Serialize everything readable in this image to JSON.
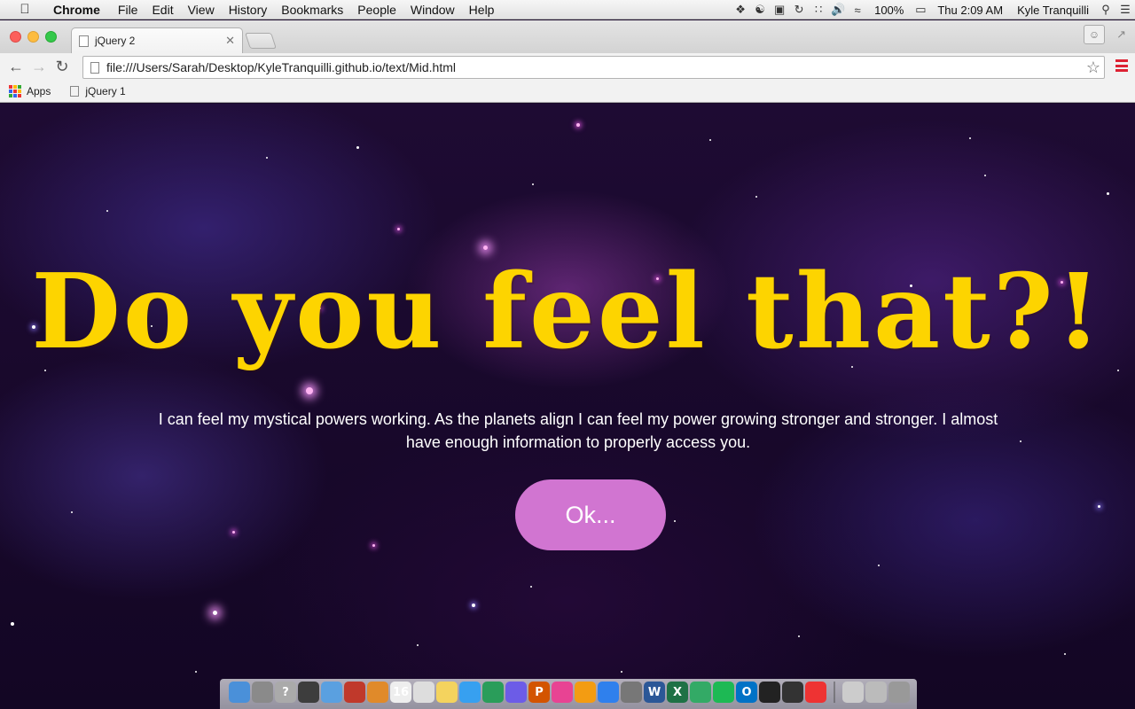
{
  "menubar": {
    "app_name": "Chrome",
    "items": [
      "File",
      "Edit",
      "View",
      "History",
      "Bookmarks",
      "People",
      "Window",
      "Help"
    ],
    "battery": "100%",
    "clock": "Thu 2:09 AM",
    "user": "Kyle Tranquilli"
  },
  "tab": {
    "title": "jQuery 2"
  },
  "toolbar": {
    "url": "file:///Users/Sarah/Desktop/KyleTranquilli.github.io/text/Mid.html"
  },
  "bookmarks": {
    "apps_label": "Apps",
    "items": [
      "jQuery 1"
    ]
  },
  "page": {
    "headline": "Do you feel that?!",
    "body": "I can feel my mystical powers working. As the planets align I can feel my power growing stronger and stronger. I almost have enough information to properly access you.",
    "button_label": "Ok..."
  },
  "colors": {
    "headline": "#fdd400",
    "button_bg": "#d175d1",
    "background": "#1e0b33"
  },
  "dock": {
    "icons": [
      "finder-icon",
      "launchpad-icon",
      "help-icon",
      "activity-monitor-icon",
      "preview-icon",
      "photobooth-icon",
      "books-icon",
      "calendar-icon",
      "textedit-icon",
      "stickies-icon",
      "messages-icon",
      "facetime-icon",
      "photos-icon",
      "powerpoint-icon",
      "itunes-icon",
      "ibooks-icon",
      "app-store-icon",
      "system-preferences-icon",
      "word-icon",
      "excel-icon",
      "xquartz-icon",
      "spotify-icon",
      "outlook-icon",
      "stepper-icon",
      "github-icon",
      "chrome-icon",
      "documents-icon",
      "downloads-icon",
      "trash-icon"
    ]
  }
}
